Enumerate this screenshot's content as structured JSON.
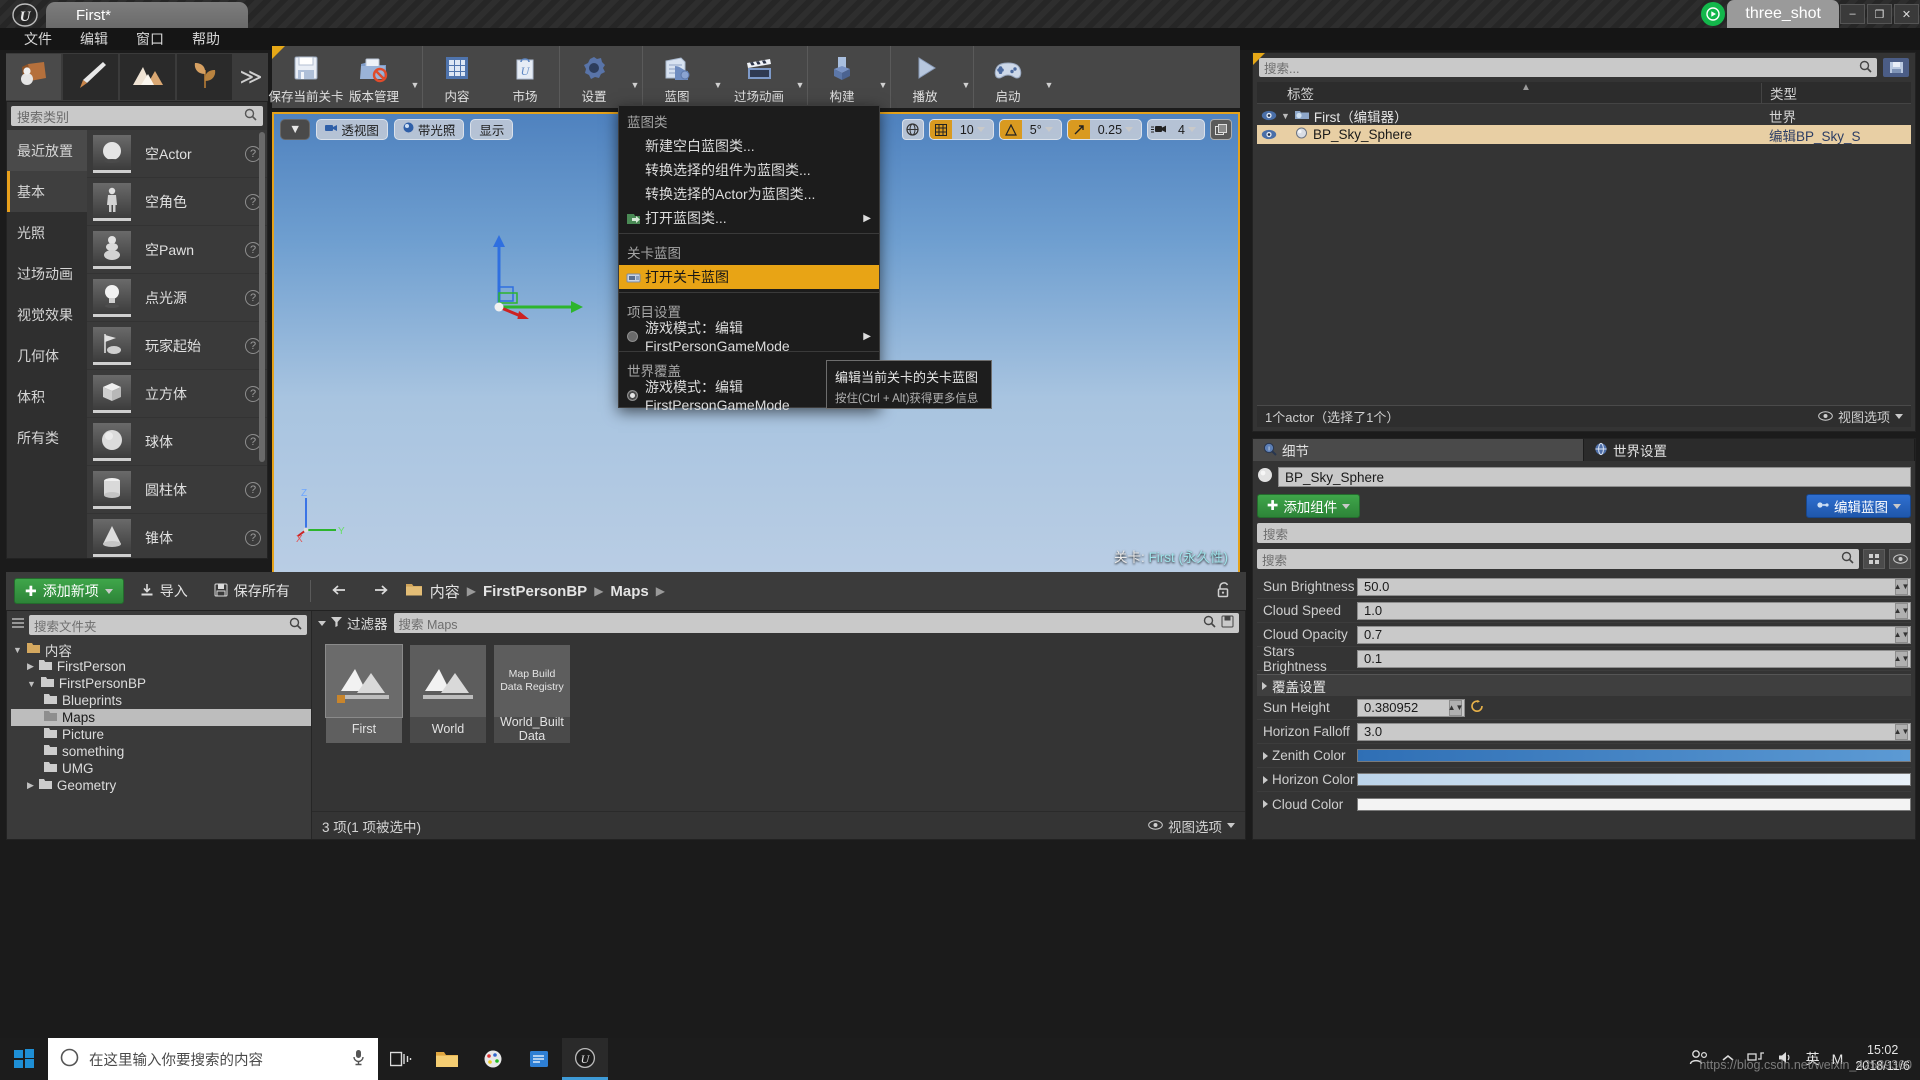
{
  "titlebar": {
    "logo_icon": "unreal-logo-icon",
    "project_tab": "First*",
    "green_badge_icon": "play-record-icon",
    "session_tab": "three_shot",
    "minimize": "–",
    "maximize": "❐",
    "close": "✕"
  },
  "menubar": {
    "items": [
      "文件",
      "编辑",
      "窗口",
      "帮助"
    ]
  },
  "modes": {
    "buttons": [
      {
        "name": "place-mode",
        "icon": "place-actors-icon"
      },
      {
        "name": "paint-mode",
        "icon": "paint-brush-icon"
      },
      {
        "name": "landscape-mode",
        "icon": "landscape-icon"
      },
      {
        "name": "foliage-mode",
        "icon": "foliage-leaf-icon"
      }
    ],
    "overflow": "≫"
  },
  "toolbar": {
    "groups": [
      {
        "items": [
          {
            "label": "保存当前关卡",
            "icon": "save-floppy-icon",
            "arrow": false
          },
          {
            "label": "版本管理",
            "icon": "source-control-icon",
            "arrow": true
          }
        ]
      },
      {
        "items": [
          {
            "label": "内容",
            "icon": "content-grid-icon",
            "arrow": false
          },
          {
            "label": "市场",
            "icon": "marketplace-bag-icon",
            "arrow": false
          }
        ]
      },
      {
        "items": [
          {
            "label": "设置",
            "icon": "settings-gear-icon",
            "arrow": true
          }
        ]
      },
      {
        "items": [
          {
            "label": "蓝图",
            "icon": "blueprint-icon",
            "arrow": true
          },
          {
            "label": "过场动画",
            "icon": "cinematics-clapboard-icon",
            "arrow": true
          }
        ]
      },
      {
        "items": [
          {
            "label": "构建",
            "icon": "build-icon",
            "arrow": true
          }
        ]
      },
      {
        "items": [
          {
            "label": "播放",
            "icon": "play-triangle-icon",
            "arrow": true
          }
        ]
      },
      {
        "items": [
          {
            "label": "启动",
            "icon": "launch-gamepad-icon",
            "arrow": true
          }
        ]
      }
    ]
  },
  "place_panel": {
    "search_placeholder": "搜索类别",
    "search_icon": "search-icon",
    "categories": [
      {
        "label": "最近放置",
        "state": "recent"
      },
      {
        "label": "基本",
        "state": "selected"
      },
      {
        "label": "光照",
        "state": ""
      },
      {
        "label": "过场动画",
        "state": ""
      },
      {
        "label": "视觉效果",
        "state": ""
      },
      {
        "label": "几何体",
        "state": ""
      },
      {
        "label": "体积",
        "state": ""
      },
      {
        "label": "所有类",
        "state": ""
      }
    ],
    "items": [
      {
        "label": "空Actor",
        "icon": "sphere-actor-icon"
      },
      {
        "label": "空角色",
        "icon": "character-icon"
      },
      {
        "label": "空Pawn",
        "icon": "pawn-icon"
      },
      {
        "label": "点光源",
        "icon": "point-light-icon"
      },
      {
        "label": "玩家起始",
        "icon": "player-start-icon"
      },
      {
        "label": "立方体",
        "icon": "cube-icon"
      },
      {
        "label": "球体",
        "icon": "sphere-icon"
      },
      {
        "label": "圆柱体",
        "icon": "cylinder-icon"
      },
      {
        "label": "锥体",
        "icon": "cone-icon"
      }
    ],
    "help_badge": "?"
  },
  "viewport": {
    "left_buttons": [
      {
        "label": "",
        "icon": "viewport-menu-icon"
      },
      {
        "label": "透视图",
        "icon": "camera-icon"
      },
      {
        "label": "带光照",
        "icon": "lit-sphere-icon"
      },
      {
        "label": "显示",
        "icon": "show-icon"
      }
    ],
    "right_controls": [
      {
        "name": "world-coords-toggle",
        "icon": "globe-icon"
      },
      {
        "name": "grid-snap-toggle",
        "icon": "grid-icon",
        "value": "10",
        "active": true
      },
      {
        "name": "rotation-snap-toggle",
        "icon": "angle-icon",
        "value": "5°",
        "active": true
      },
      {
        "name": "scale-snap-toggle",
        "icon": "scale-arrow-icon",
        "value": "0.25",
        "active": true
      },
      {
        "name": "camera-speed",
        "icon": "camera-speed-icon",
        "value": "4",
        "active": false
      },
      {
        "name": "maximize-viewport",
        "icon": "maximize-icon"
      }
    ],
    "level_label": "关卡:",
    "level_name": "First",
    "level_suffix": "(永久性)",
    "gizmo_axes": [
      "Z",
      "X",
      "Y"
    ]
  },
  "blueprint_menu": {
    "sections": [
      {
        "header": "蓝图类",
        "items": [
          {
            "label": "新建空白蓝图类...",
            "icon": "",
            "arrow": false,
            "highlight": false
          },
          {
            "label": "转换选择的组件为蓝图类...",
            "icon": "",
            "arrow": false,
            "highlight": false
          },
          {
            "label": "转换选择的Actor为蓝图类...",
            "icon": "",
            "arrow": false,
            "highlight": false
          },
          {
            "label": "打开蓝图类...",
            "icon": "open-blueprint-icon",
            "arrow": true,
            "highlight": false
          }
        ]
      },
      {
        "header": "关卡蓝图",
        "items": [
          {
            "label": "打开关卡蓝图",
            "icon": "level-blueprint-icon",
            "arrow": false,
            "highlight": true
          }
        ]
      },
      {
        "header": "项目设置",
        "items": [
          {
            "label": "游戏模式：编辑 FirstPersonGameMode",
            "icon": "radio-off",
            "arrow": true,
            "highlight": false
          }
        ]
      },
      {
        "header": "世界覆盖",
        "items": [
          {
            "label": "游戏模式：编辑 FirstPersonGameMode",
            "icon": "radio-on",
            "arrow": true,
            "highlight": false
          }
        ]
      }
    ]
  },
  "tooltip": {
    "line1": "编辑当前关卡的关卡蓝图",
    "line2": "按住(Ctrl + Alt)获得更多信息"
  },
  "outliner": {
    "search_placeholder": "搜索...",
    "search_icon": "search-icon",
    "save_icon": "save-layout-icon",
    "columns": [
      "标签",
      "类型"
    ],
    "rows": [
      {
        "eye": "eye-icon",
        "icon": "world-icon",
        "name": "First（编辑器）",
        "type": "世界",
        "selected": false
      },
      {
        "eye": "eye-icon",
        "icon": "actor-icon",
        "name": "BP_Sky_Sphere",
        "type": "编辑BP_Sky_S",
        "selected": true
      }
    ],
    "status": "1个actor（选择了1个）",
    "view_options": "视图选项",
    "view_options_icon": "eye-icon"
  },
  "details": {
    "tabs": [
      {
        "label": "细节",
        "icon": "details-magnifier-icon",
        "active": true
      },
      {
        "label": "世界设置",
        "icon": "world-settings-icon",
        "active": false
      }
    ],
    "actor_name": "BP_Sky_Sphere",
    "actor_icon": "sphere-icon",
    "add_component_label": "添加组件",
    "add_component_icon": "plus-icon",
    "edit_blueprint_label": "编辑蓝图",
    "edit_blueprint_icon": "blueprint-small-icon",
    "search_placeholder_1": "搜索",
    "search_placeholder_2": "搜索",
    "search_icon": "search-icon",
    "grid_view_icon": "grid-view-icon",
    "eye_icon": "eye-icon",
    "properties": [
      {
        "label": "Sun Brightness",
        "value": "50.0"
      },
      {
        "label": "Cloud Speed",
        "value": "1.0"
      },
      {
        "label": "Cloud Opacity",
        "value": "0.7"
      },
      {
        "label": "Stars Brightness",
        "value": "0.1"
      }
    ],
    "section_header": "覆盖设置",
    "override_properties": [
      {
        "label": "Sun Height",
        "value": "0.380952",
        "type": "number",
        "has_reset": true
      },
      {
        "label": "Horizon Falloff",
        "value": "3.0",
        "type": "number",
        "has_reset": false
      },
      {
        "label": "Zenith Color",
        "value": "",
        "type": "color",
        "color": "#3b7fc4",
        "expandable": true
      },
      {
        "label": "Horizon Color",
        "value": "",
        "type": "color",
        "color": "#cfe0ef",
        "expandable": true
      },
      {
        "label": "Cloud Color",
        "value": "",
        "type": "color",
        "color": "#f2f2f2",
        "expandable": true
      }
    ]
  },
  "content_browser": {
    "add_new_label": "添加新项",
    "add_new_icon": "plus-icon",
    "import_label": "导入",
    "import_icon": "import-icon",
    "save_all_label": "保存所有",
    "save_all_icon": "save-icon",
    "back_icon": "arrow-left-icon",
    "forward_icon": "arrow-right-icon",
    "folder_icon": "folder-icon",
    "breadcrumb": [
      "内容",
      "FirstPersonBP",
      "Maps"
    ],
    "lock_icon": "lock-icon",
    "folder_search_placeholder": "搜索文件夹",
    "filter_label": "过滤器",
    "filter_icon": "filter-icon",
    "asset_search_placeholder": "搜索 Maps",
    "tree": [
      {
        "label": "内容",
        "depth": 0,
        "expanded": true,
        "folder": true,
        "selected": false
      },
      {
        "label": "FirstPerson",
        "depth": 1,
        "expanded": false,
        "folder": true,
        "selected": false
      },
      {
        "label": "FirstPersonBP",
        "depth": 1,
        "expanded": true,
        "folder": true,
        "selected": false
      },
      {
        "label": "Blueprints",
        "depth": 2,
        "expanded": false,
        "folder": true,
        "selected": false
      },
      {
        "label": "Maps",
        "depth": 2,
        "expanded": false,
        "folder": true,
        "selected": true
      },
      {
        "label": "Picture",
        "depth": 2,
        "expanded": false,
        "folder": true,
        "selected": false
      },
      {
        "label": "something",
        "depth": 2,
        "expanded": false,
        "folder": true,
        "selected": false
      },
      {
        "label": "UMG",
        "depth": 2,
        "expanded": false,
        "folder": true,
        "selected": false
      },
      {
        "label": "Geometry",
        "depth": 1,
        "expanded": false,
        "folder": true,
        "selected": false
      }
    ],
    "assets": [
      {
        "name": "First",
        "kind": "map",
        "selected": true,
        "thumb_text": ""
      },
      {
        "name": "World",
        "kind": "map",
        "selected": false,
        "thumb_text": ""
      },
      {
        "name": "World_Built\nData",
        "kind": "data",
        "selected": false,
        "thumb_text": "Map Build\nData Registry"
      }
    ],
    "status": "3 项(1 项被选中)",
    "view_options": "视图选项",
    "view_options_icon": "eye-icon"
  },
  "taskbar": {
    "start_icon": "windows-start-icon",
    "search_icon": "cortana-circle-icon",
    "search_placeholder": "在这里输入你要搜索的内容",
    "mic_icon": "microphone-icon",
    "pinned": [
      {
        "name": "task-view-icon"
      },
      {
        "name": "file-explorer-icon"
      },
      {
        "name": "paint-icon"
      },
      {
        "name": "editor-icon"
      },
      {
        "name": "unreal-taskbar-icon"
      }
    ],
    "tray": [
      {
        "name": "people-icon"
      },
      {
        "name": "chevron-up-icon"
      },
      {
        "name": "network-icon"
      },
      {
        "name": "volume-icon"
      },
      {
        "name": "ime-icon",
        "label": "英"
      },
      {
        "name": "ime-mode-icon",
        "label": "M"
      }
    ],
    "time": "15:02",
    "date": "2018/11/6"
  },
  "watermark": "https://blog.csdn.net/weixin_42589360",
  "colors": {
    "accent_orange": "#e8a415",
    "green": "#3fa64a",
    "blue": "#2f6fd0",
    "panel_bg": "#343434",
    "toolbar_bg": "#474747"
  }
}
